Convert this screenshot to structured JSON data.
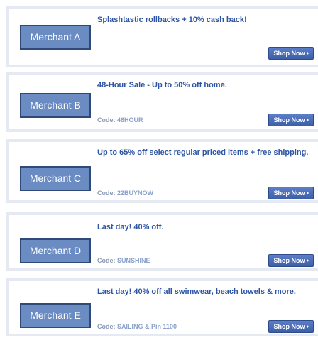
{
  "deals": [
    {
      "merchant": "Merchant A",
      "title": "Splashtastic rollbacks + 10% cash back!",
      "code_label": "",
      "code": "",
      "button_label": "Shop Now"
    },
    {
      "merchant": "Merchant B",
      "title": "48-Hour Sale - Up to 50% off home.",
      "code_label": "Code:",
      "code": "48HOUR",
      "button_label": "Shop Now"
    },
    {
      "merchant": "Merchant C",
      "title": "Up to 65% off select regular priced items + free shipping.",
      "code_label": "Code:",
      "code": "22BUYNOW",
      "button_label": "Shop Now"
    },
    {
      "merchant": "Merchant D",
      "title": "Last day! 40% off.",
      "code_label": "Code:",
      "code": "SUNSHINE",
      "button_label": "Shop Now"
    },
    {
      "merchant": "Merchant E",
      "title": "Last day! 40% off all swimwear, beach towels & more.",
      "code_label": "Code:",
      "code": "SAILING & Pin 1100",
      "button_label": "Shop Now"
    }
  ]
}
